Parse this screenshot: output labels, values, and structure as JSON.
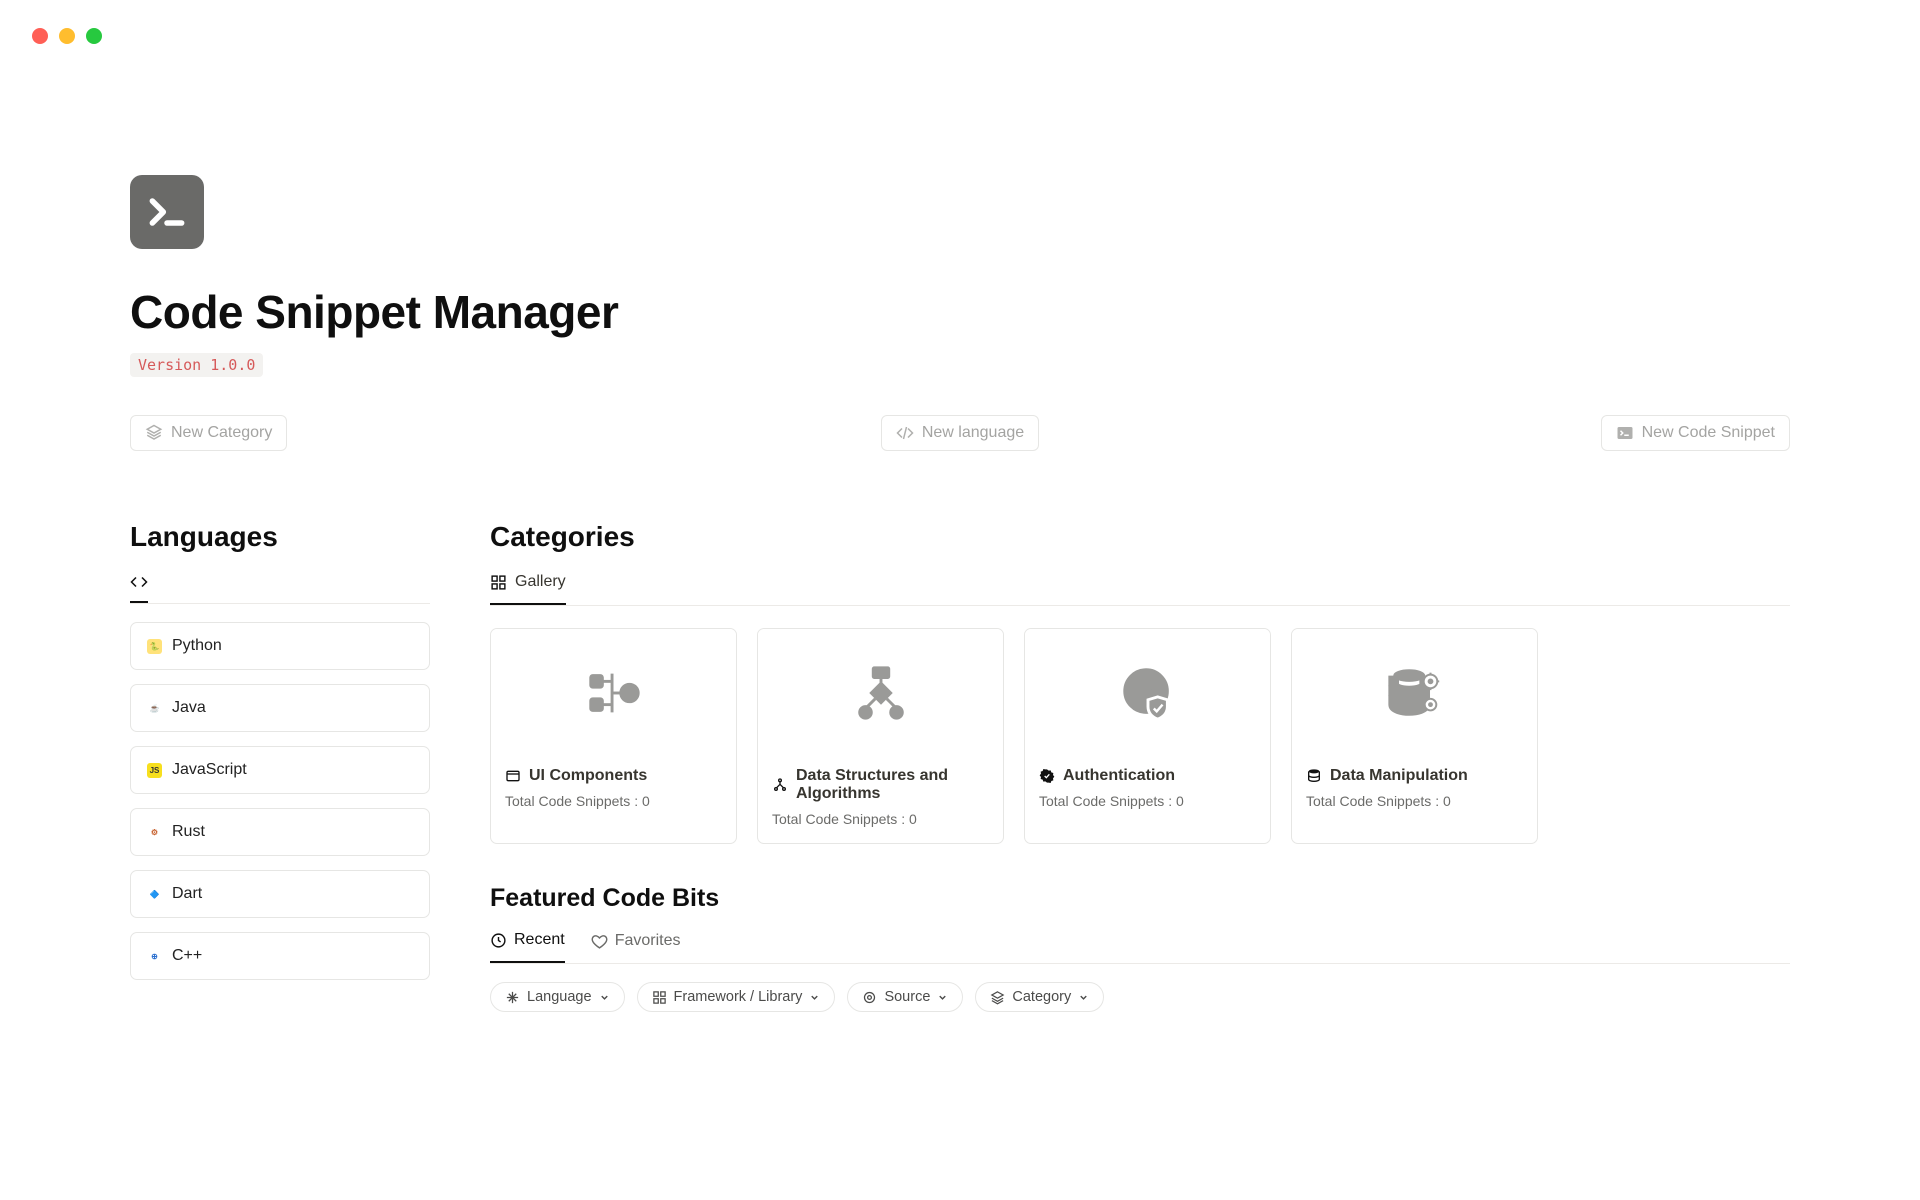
{
  "header": {
    "title": "Code Snippet Manager",
    "version": "Version 1.0.0"
  },
  "actions": {
    "new_category": "New Category",
    "new_language": "New language",
    "new_snippet": "New Code Snippet"
  },
  "languages": {
    "section_title": "Languages",
    "items": [
      {
        "label": "Python",
        "icon_bg": "#ffe27a",
        "glyph": "🐍"
      },
      {
        "label": "Java",
        "icon_bg": "#ffffff",
        "glyph": "☕"
      },
      {
        "label": "JavaScript",
        "icon_bg": "#F7DF1E",
        "glyph": "JS"
      },
      {
        "label": "Rust",
        "icon_bg": "#ffffff",
        "glyph": "⚙"
      },
      {
        "label": "Dart",
        "icon_bg": "#ffffff",
        "glyph": "🔷"
      },
      {
        "label": "C++",
        "icon_bg": "#ffffff",
        "glyph": "⊕"
      }
    ]
  },
  "categories": {
    "section_title": "Categories",
    "tab_label": "Gallery",
    "snippet_count_prefix": "Total Code Snippets : ",
    "items": [
      {
        "title": "UI Components",
        "count": 0,
        "icon": "ui"
      },
      {
        "title": "Data Structures and Algorithms",
        "count": 0,
        "icon": "dsa"
      },
      {
        "title": "Authentication",
        "count": 0,
        "icon": "auth"
      },
      {
        "title": "Data Manipulation",
        "count": 0,
        "icon": "db"
      }
    ]
  },
  "featured": {
    "section_title": "Featured Code Bits",
    "tabs": {
      "recent": "Recent",
      "favorites": "Favorites"
    },
    "filters": [
      {
        "label": "Language",
        "icon": "sparkle"
      },
      {
        "label": "Framework / Library",
        "icon": "grid"
      },
      {
        "label": "Source",
        "icon": "target"
      },
      {
        "label": "Category",
        "icon": "layers"
      }
    ]
  }
}
